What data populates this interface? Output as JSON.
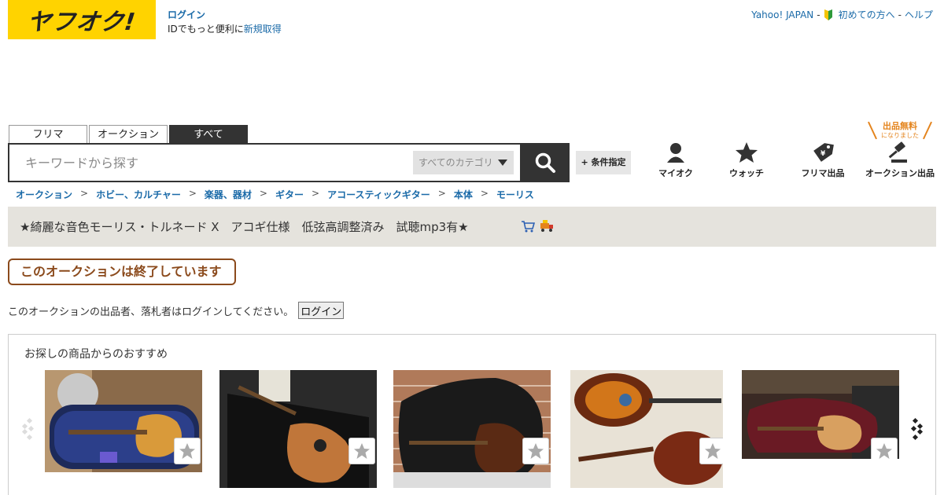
{
  "logo": {
    "text": "ヤフオク!"
  },
  "account": {
    "login_label": "ログイン",
    "id_text": "IDでもっと便利に",
    "register_label": "新規取得"
  },
  "toplinks": {
    "yahoo_japan": "Yahoo! JAPAN",
    "beginner": "初めての方へ",
    "help": "ヘルプ",
    "sep": "-"
  },
  "search": {
    "tabs": [
      {
        "label": "フリマ"
      },
      {
        "label": "オークション"
      },
      {
        "label": "すべて"
      }
    ],
    "placeholder": "キーワードから探す",
    "category": "すべてのカテゴリ",
    "conditions_label": "+ 条件指定"
  },
  "free_badge": {
    "main": "出品無料",
    "sub": "になりました"
  },
  "nav": [
    {
      "label": "マイオク",
      "icon": "person-icon"
    },
    {
      "label": "ウォッチ",
      "icon": "star-icon"
    },
    {
      "label": "フリマ出品",
      "icon": "price-tag-icon"
    },
    {
      "label": "オークション出品",
      "icon": "gavel-icon"
    }
  ],
  "breadcrumb": [
    "オークション",
    "ホビー、カルチャー",
    "楽器、器材",
    "ギター",
    "アコースティックギター",
    "本体",
    "モーリス"
  ],
  "breadcrumb_sep": ">",
  "item": {
    "title": "★綺麗な音色モーリス・トルネード X　アコギ仕様　低弦高調整済み　試聴mp3有★"
  },
  "status": {
    "ended": "このオークションは終了しています"
  },
  "login_message": {
    "text": "このオークションの出品者、落札者はログインしてください。",
    "button": "ログイン"
  },
  "recommendations": {
    "title": "お探しの商品からのおすすめ",
    "items": [
      {
        "name": "guitar-in-blue-case"
      },
      {
        "name": "guitar-in-hard-case"
      },
      {
        "name": "guitar-in-gig-bag"
      },
      {
        "name": "sunburst-ovation-guitar"
      },
      {
        "name": "guitar-in-maroon-case"
      }
    ]
  },
  "colors": {
    "brand_yellow": "#ffd300",
    "link_blue": "#1a6aa8",
    "ended_brown": "#8b4a1c",
    "free_orange": "#e4841d",
    "band_beige": "#e5e3dd"
  }
}
